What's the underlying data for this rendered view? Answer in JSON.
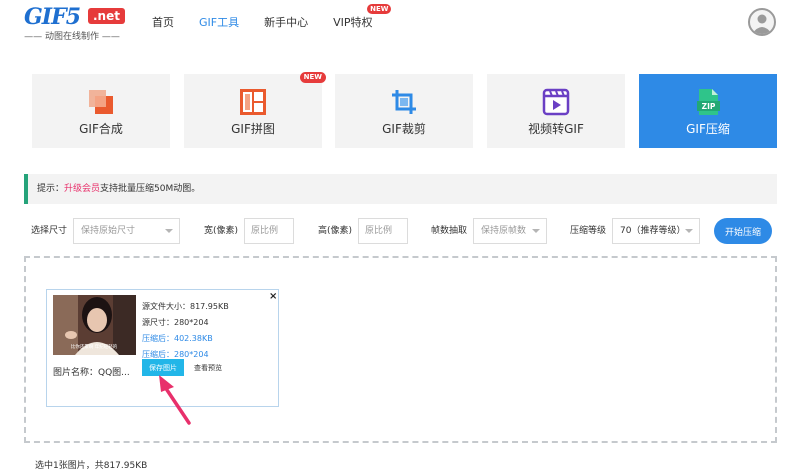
{
  "header": {
    "logo_main": "GIF5",
    "logo_net": ".net",
    "logo_sub": "—— 动图在线制作 ——",
    "nav": [
      {
        "label": "首页"
      },
      {
        "label": "GIF工具"
      },
      {
        "label": "新手中心"
      },
      {
        "label": "VIP特权",
        "badge": "NEW"
      }
    ]
  },
  "tools": [
    {
      "label": "GIF合成",
      "icon": "merge-icon"
    },
    {
      "label": "GIF拼图",
      "icon": "collage-icon",
      "badge": "NEW"
    },
    {
      "label": "GIF裁剪",
      "icon": "crop-icon"
    },
    {
      "label": "视频转GIF",
      "icon": "video-icon"
    },
    {
      "label": "GIF压缩",
      "icon": "zip-icon"
    }
  ],
  "tip": {
    "prefix": "提示：",
    "link": "升级会员",
    "suffix": "支持批量压缩50M动图。"
  },
  "options": {
    "size_label": "选择尺寸",
    "size_value": "保持原始尺寸",
    "width_label": "宽(像素)",
    "width_placeholder": "原比例",
    "height_label": "高(像素)",
    "height_placeholder": "原比例",
    "frame_label": "帧数抽取",
    "frame_value": "保持原帧数",
    "level_label": "压缩等级",
    "level_value": "70（推荐等级）",
    "start_button": "开始压缩"
  },
  "card": {
    "close": "×",
    "thumb_caption": "比你还累啊 年纪轻轻的",
    "original_size": "源文件大小：817.95KB",
    "original_dims": "源尺寸：280*204",
    "compressed_size": "压缩后：402.38KB",
    "compressed_dims": "压缩后：280*204",
    "name": "图片名称：QQ图...",
    "save_button": "保存图片",
    "preview_link": "查看预览"
  },
  "footer": {
    "summary": "选中1张图片，共817.95KB"
  },
  "colors": {
    "accent": "#2e8ae6",
    "tool_bg": "#f3f3f3",
    "badge_red": "#e63b3b",
    "tip_border": "#25a37a",
    "link_pink": "#e8306b",
    "save_button": "#22b6e8",
    "arrow": "#e8306b"
  }
}
